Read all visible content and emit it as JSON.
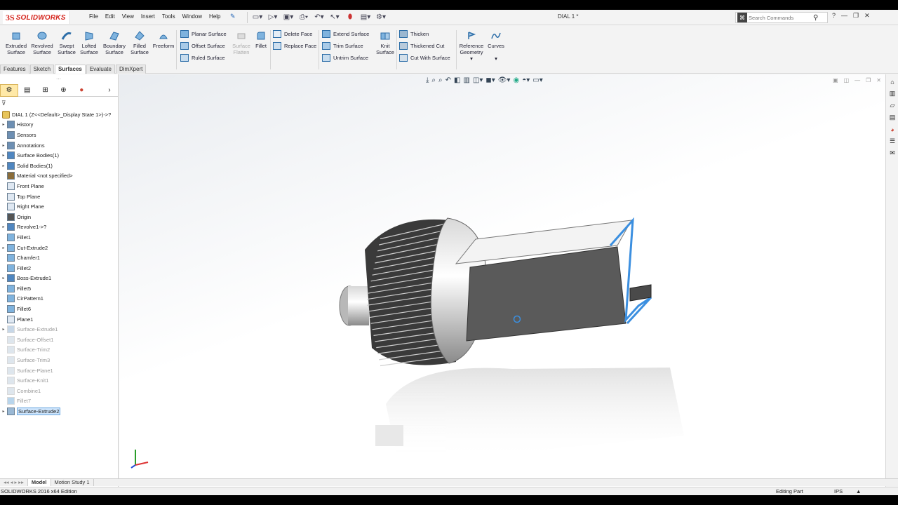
{
  "app": {
    "brand": "SOLIDWORKS",
    "ds": "3S",
    "doc_title": "DIAL 1 *"
  },
  "menu": [
    "File",
    "Edit",
    "View",
    "Insert",
    "Tools",
    "Window",
    "Help"
  ],
  "search": {
    "placeholder": "Search Commands",
    "help": "?"
  },
  "ribbon": {
    "big_buttons": [
      {
        "label1": "Extruded",
        "label2": "Surface"
      },
      {
        "label1": "Revolved",
        "label2": "Surface"
      },
      {
        "label1": "Swept",
        "label2": "Surface"
      },
      {
        "label1": "Lofted",
        "label2": "Surface"
      },
      {
        "label1": "Boundary",
        "label2": "Surface"
      },
      {
        "label1": "Filled",
        "label2": "Surface"
      },
      {
        "label1": "Freeform",
        "label2": ""
      }
    ],
    "col1": [
      "Planar Surface",
      "Offset Surface",
      "Ruled Surface"
    ],
    "flatten": {
      "label1": "Surface",
      "label2": "Flatten"
    },
    "fillet": "Fillet",
    "col2": [
      "Delete Face",
      "Replace Face"
    ],
    "col3": [
      "Extend Surface",
      "Trim Surface",
      "Untrim Surface"
    ],
    "knit": {
      "label1": "Knit",
      "label2": "Surface"
    },
    "col4": [
      "Thicken",
      "Thickened Cut",
      "Cut With Surface"
    ],
    "refgeo": {
      "label1": "Reference",
      "label2": "Geometry"
    },
    "curves": "Curves"
  },
  "tabs": [
    "Features",
    "Sketch",
    "Surfaces",
    "Evaluate",
    "DimXpert"
  ],
  "active_tab": "Surfaces",
  "tree": {
    "root": "DIAL 1  (Z<<Default>_Display State 1>)->?",
    "items": [
      {
        "label": "History",
        "exp": true,
        "grey": false,
        "icon": "history-icon"
      },
      {
        "label": "Sensors",
        "exp": false,
        "grey": false,
        "icon": "sensor-icon"
      },
      {
        "label": "Annotations",
        "exp": true,
        "grey": false,
        "icon": "annotation-icon"
      },
      {
        "label": "Surface Bodies(1)",
        "exp": true,
        "grey": false,
        "icon": "surface-bodies-icon"
      },
      {
        "label": "Solid Bodies(1)",
        "exp": true,
        "grey": false,
        "icon": "solid-bodies-icon"
      },
      {
        "label": "Material <not specified>",
        "exp": false,
        "grey": false,
        "icon": "material-icon"
      },
      {
        "label": "Front Plane",
        "exp": false,
        "grey": false,
        "icon": "plane-icon"
      },
      {
        "label": "Top Plane",
        "exp": false,
        "grey": false,
        "icon": "plane-icon"
      },
      {
        "label": "Right Plane",
        "exp": false,
        "grey": false,
        "icon": "plane-icon"
      },
      {
        "label": "Origin",
        "exp": false,
        "grey": false,
        "icon": "origin-icon"
      },
      {
        "label": "Revolve1->?",
        "exp": true,
        "grey": false,
        "icon": "revolve-icon"
      },
      {
        "label": "Fillet1",
        "exp": false,
        "grey": false,
        "icon": "fillet-icon"
      },
      {
        "label": "Cut-Extrude2",
        "exp": true,
        "grey": false,
        "icon": "cut-extrude-icon"
      },
      {
        "label": "Chamfer1",
        "exp": false,
        "grey": false,
        "icon": "chamfer-icon"
      },
      {
        "label": "Fillet2",
        "exp": false,
        "grey": false,
        "icon": "fillet-icon"
      },
      {
        "label": "Boss-Extrude1",
        "exp": true,
        "grey": false,
        "icon": "boss-extrude-icon"
      },
      {
        "label": "Fillet5",
        "exp": false,
        "grey": false,
        "icon": "fillet-icon"
      },
      {
        "label": "CirPattern1",
        "exp": false,
        "grey": false,
        "icon": "pattern-icon"
      },
      {
        "label": "Fillet6",
        "exp": false,
        "grey": false,
        "icon": "fillet-icon"
      },
      {
        "label": "Plane1",
        "exp": false,
        "grey": false,
        "icon": "plane-icon"
      },
      {
        "label": "Surface-Extrude1",
        "exp": true,
        "grey": true,
        "icon": "surface-extrude-icon"
      },
      {
        "label": "Surface-Offset1",
        "exp": false,
        "grey": true,
        "icon": "surface-offset-icon"
      },
      {
        "label": "Surface-Trim2",
        "exp": false,
        "grey": true,
        "icon": "surface-trim-icon"
      },
      {
        "label": "Surface-Trim3",
        "exp": false,
        "grey": true,
        "icon": "surface-trim-icon"
      },
      {
        "label": "Surface-Plane1",
        "exp": false,
        "grey": true,
        "icon": "surface-plane-icon"
      },
      {
        "label": "Surface-Knit1",
        "exp": false,
        "grey": true,
        "icon": "surface-knit-icon"
      },
      {
        "label": "Combine1",
        "exp": false,
        "grey": true,
        "icon": "combine-icon"
      },
      {
        "label": "Fillet7",
        "exp": false,
        "grey": true,
        "icon": "fillet-icon"
      },
      {
        "label": "Surface-Extrude2",
        "exp": true,
        "grey": false,
        "icon": "surface-extrude-icon",
        "selected": true
      }
    ]
  },
  "bottom_tabs": [
    "Model",
    "Motion Study 1"
  ],
  "status": {
    "edition": "SOLIDWORKS 2016 x64 Edition",
    "mode": "Editing Part",
    "units": "IPS",
    "arrow": "▲"
  },
  "colors": {
    "brand_red": "#d5261e",
    "selection_blue": "#3b8fe0",
    "knurl_dark": "#2a2a2a",
    "body_grey": "#5a5a5a"
  }
}
